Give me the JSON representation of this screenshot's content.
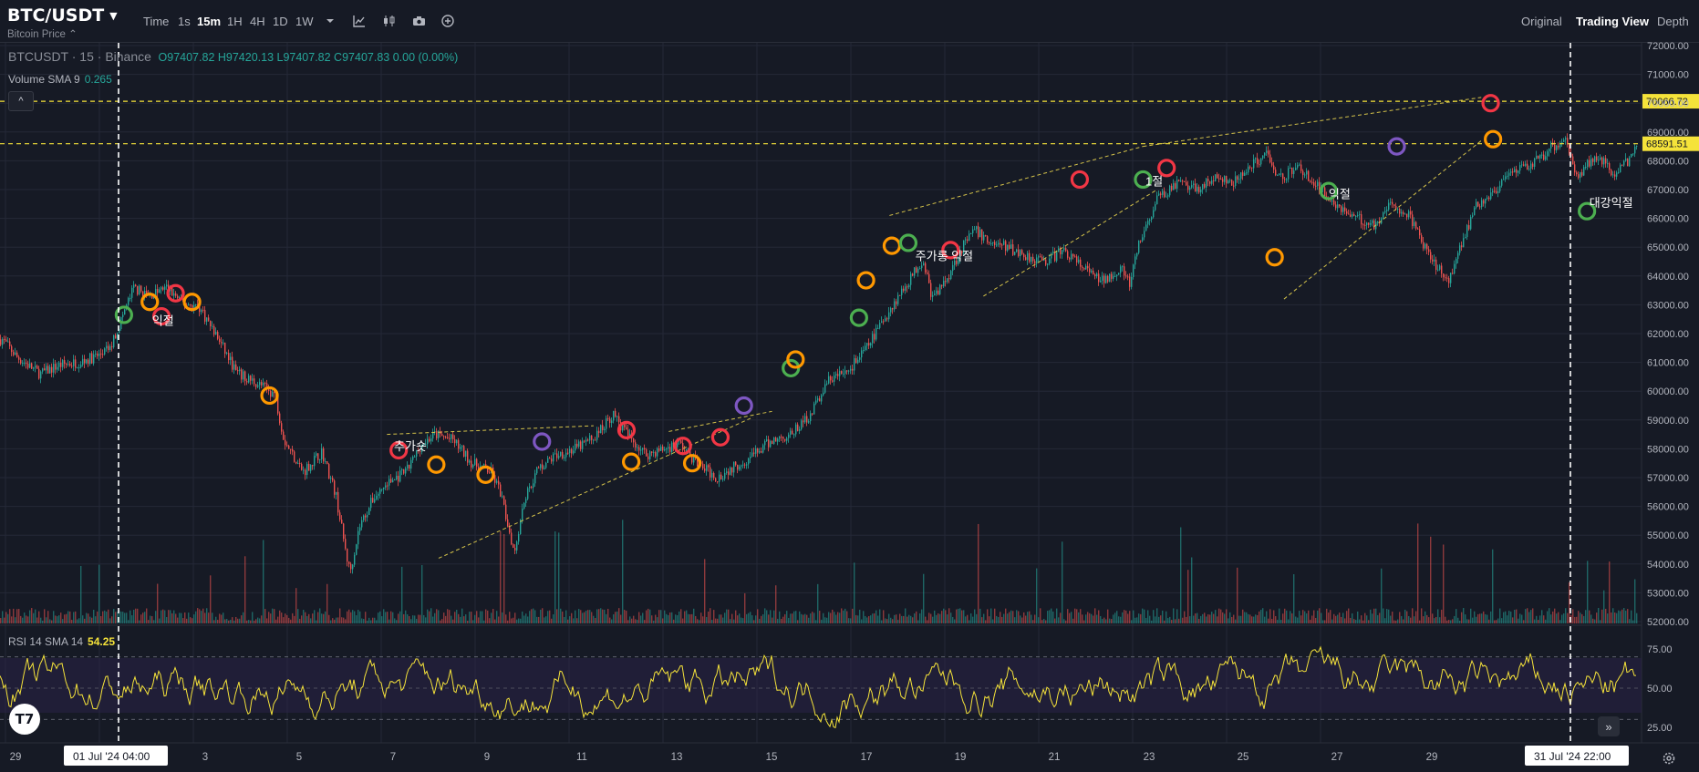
{
  "header": {
    "symbol": "BTC/USDT",
    "subtitle": "Bitcoin Price ⌃",
    "timeframes": [
      {
        "label": "Time",
        "active": false
      },
      {
        "label": "1s",
        "active": false
      },
      {
        "label": "15m",
        "active": true
      },
      {
        "label": "1H",
        "active": false
      },
      {
        "label": "4H",
        "active": false
      },
      {
        "label": "1D",
        "active": false
      },
      {
        "label": "1W",
        "active": false
      }
    ],
    "tools": [
      "chevron-down-icon",
      "indicators-icon",
      "chart-type-icon",
      "camera-icon",
      "add-icon"
    ],
    "view_tabs": [
      {
        "label": "Original",
        "active": false
      },
      {
        "label": "Trading View",
        "active": true
      },
      {
        "label": "Depth",
        "active": false
      }
    ]
  },
  "legend": {
    "symbol_line": "BTCUSDT · 15 · Binance",
    "ohlc": "O97407.82  H97420.13  L97407.82  C97407.83  0.00 (0.00%)",
    "volume_label": "Volume SMA 9",
    "volume_value": "0.265",
    "collapse_glyph": "^",
    "rsi_label": "RSI 14 SMA 14",
    "rsi_value": "54.25"
  },
  "colors": {
    "bg": "#161a25",
    "up": "#26a69a",
    "down": "#ef5350",
    "hline": "#f5e33a",
    "rsi": "#f5e33a",
    "marker_green": "#4caf50",
    "marker_orange": "#ff9800",
    "marker_red": "#f23645",
    "marker_purple": "#7e57c2"
  },
  "chart_data": {
    "type": "candlestick",
    "symbol": "BTCUSDT",
    "interval": "15",
    "ylim": [
      52000,
      72000
    ],
    "y_ticks": [
      "72000.00",
      "71000.00",
      "70000.00",
      "69000.00",
      "68000.00",
      "67000.00",
      "66000.00",
      "65000.00",
      "64000.00",
      "63000.00",
      "62000.00",
      "61000.00",
      "60000.00",
      "59000.00",
      "58000.00",
      "57000.00",
      "56000.00",
      "55000.00",
      "54000.00",
      "53000.00",
      "52000.00"
    ],
    "x_ticks": [
      "29",
      "3",
      "5",
      "7",
      "9",
      "11",
      "13",
      "15",
      "17",
      "19",
      "21",
      "23",
      "25",
      "27",
      "29"
    ],
    "cursor_dates": [
      "01 Jul '24  04:00",
      "31 Jul '24  22:00"
    ],
    "price_lines": [
      {
        "value": 70066.72,
        "label": "70066.72"
      },
      {
        "value": 68591.51,
        "label": "68591.51"
      }
    ],
    "price_path": [
      [
        0,
        61800
      ],
      [
        0.3,
        61200
      ],
      [
        0.8,
        60600
      ],
      [
        1.2,
        60900
      ],
      [
        1.6,
        61000
      ],
      [
        2,
        61200
      ],
      [
        2.3,
        61500
      ],
      [
        2.6,
        62800
      ],
      [
        2.8,
        63600
      ],
      [
        3.1,
        63300
      ],
      [
        3.5,
        63600
      ],
      [
        3.8,
        63100
      ],
      [
        4.2,
        62900
      ],
      [
        4.6,
        61800
      ],
      [
        5.0,
        60600
      ],
      [
        5.4,
        60300
      ],
      [
        5.8,
        59900
      ],
      [
        6.0,
        58300
      ],
      [
        6.4,
        57200
      ],
      [
        6.8,
        57900
      ],
      [
        7.1,
        56400
      ],
      [
        7.3,
        54500
      ],
      [
        7.4,
        53700
      ],
      [
        7.6,
        55300
      ],
      [
        7.9,
        56300
      ],
      [
        8.2,
        56800
      ],
      [
        8.6,
        57200
      ],
      [
        8.9,
        58100
      ],
      [
        9.2,
        58500
      ],
      [
        9.6,
        58300
      ],
      [
        10.0,
        57500
      ],
      [
        10.4,
        57200
      ],
      [
        10.6,
        56500
      ],
      [
        10.9,
        54400
      ],
      [
        11.1,
        56200
      ],
      [
        11.4,
        57300
      ],
      [
        11.8,
        57800
      ],
      [
        12.2,
        58000
      ],
      [
        12.6,
        58400
      ],
      [
        13.0,
        59200
      ],
      [
        13.3,
        58500
      ],
      [
        13.7,
        57800
      ],
      [
        14.1,
        58000
      ],
      [
        14.4,
        58200
      ],
      [
        14.8,
        57500
      ],
      [
        15.2,
        57000
      ],
      [
        15.6,
        57400
      ],
      [
        16.0,
        57800
      ],
      [
        16.4,
        58300
      ],
      [
        16.8,
        58500
      ],
      [
        17.2,
        59200
      ],
      [
        17.6,
        60400
      ],
      [
        18.0,
        60700
      ],
      [
        18.4,
        61500
      ],
      [
        18.8,
        62600
      ],
      [
        19.2,
        63600
      ],
      [
        19.6,
        64600
      ],
      [
        19.8,
        63200
      ],
      [
        20.1,
        63900
      ],
      [
        20.4,
        64900
      ],
      [
        20.7,
        65600
      ],
      [
        21.0,
        65200
      ],
      [
        21.4,
        65000
      ],
      [
        21.8,
        64700
      ],
      [
        22.2,
        64500
      ],
      [
        22.6,
        64900
      ],
      [
        23.0,
        64300
      ],
      [
        23.4,
        63800
      ],
      [
        23.8,
        64300
      ],
      [
        24.0,
        63700
      ],
      [
        24.2,
        65100
      ],
      [
        24.6,
        66700
      ],
      [
        25.0,
        67200
      ],
      [
        25.4,
        67000
      ],
      [
        25.8,
        67400
      ],
      [
        26.2,
        67200
      ],
      [
        26.6,
        67800
      ],
      [
        26.9,
        68300
      ],
      [
        27.2,
        67400
      ],
      [
        27.6,
        67800
      ],
      [
        28.0,
        67100
      ],
      [
        28.4,
        66500
      ],
      [
        28.8,
        66000
      ],
      [
        29.2,
        65800
      ],
      [
        29.6,
        66500
      ],
      [
        30.0,
        66000
      ],
      [
        30.2,
        65200
      ],
      [
        30.5,
        64400
      ],
      [
        30.8,
        63900
      ],
      [
        31.0,
        64900
      ],
      [
        31.4,
        66500
      ],
      [
        31.8,
        67000
      ],
      [
        32.2,
        67600
      ],
      [
        32.6,
        67900
      ],
      [
        33.0,
        68500
      ],
      [
        33.3,
        68800
      ],
      [
        33.5,
        67400
      ],
      [
        33.9,
        68200
      ],
      [
        34.3,
        67600
      ],
      [
        34.7,
        68100
      ],
      [
        35.0,
        69400
      ],
      [
        35.3,
        70000
      ],
      [
        35.5,
        68800
      ],
      [
        35.9,
        66500
      ],
      [
        36.2,
        66800
      ],
      [
        36.6,
        66400
      ],
      [
        37.0,
        66100
      ],
      [
        37.4,
        66300
      ],
      [
        37.8,
        66000
      ],
      [
        38.2,
        65600
      ],
      [
        38.6,
        64100
      ],
      [
        38.9,
        63500
      ],
      [
        39.1,
        64300
      ],
      [
        39.3,
        62600
      ],
      [
        39.5,
        63300
      ],
      [
        39.8,
        65200
      ]
    ],
    "markers": [
      {
        "date": 2.6,
        "price": 62650,
        "color": "green"
      },
      {
        "date": 3.15,
        "price": 63100,
        "color": "orange"
      },
      {
        "date": 3.4,
        "price": 62600,
        "color": "red"
      },
      {
        "date": 3.7,
        "price": 63400,
        "color": "red"
      },
      {
        "date": 4.05,
        "price": 63100,
        "color": "orange"
      },
      {
        "date": 5.7,
        "price": 59850,
        "color": "orange"
      },
      {
        "date": 8.45,
        "price": 57950,
        "color": "red"
      },
      {
        "date": 9.25,
        "price": 57450,
        "color": "orange"
      },
      {
        "date": 10.3,
        "price": 57100,
        "color": "orange"
      },
      {
        "date": 11.5,
        "price": 58250,
        "color": "purple"
      },
      {
        "date": 13.3,
        "price": 58650,
        "color": "red"
      },
      {
        "date": 13.4,
        "price": 57550,
        "color": "orange"
      },
      {
        "date": 14.5,
        "price": 58100,
        "color": "red"
      },
      {
        "date": 14.7,
        "price": 57500,
        "color": "orange"
      },
      {
        "date": 15.3,
        "price": 58400,
        "color": "red"
      },
      {
        "date": 15.8,
        "price": 59500,
        "color": "purple"
      },
      {
        "date": 16.8,
        "price": 60800,
        "color": "green"
      },
      {
        "date": 16.9,
        "price": 61100,
        "color": "orange"
      },
      {
        "date": 18.25,
        "price": 62550,
        "color": "green"
      },
      {
        "date": 18.4,
        "price": 63850,
        "color": "orange"
      },
      {
        "date": 18.95,
        "price": 65050,
        "color": "orange"
      },
      {
        "date": 19.3,
        "price": 65150,
        "color": "green"
      },
      {
        "date": 20.2,
        "price": 64900,
        "color": "red"
      },
      {
        "date": 22.95,
        "price": 67350,
        "color": "red"
      },
      {
        "date": 24.3,
        "price": 67350,
        "color": "green"
      },
      {
        "date": 24.8,
        "price": 67750,
        "color": "red"
      },
      {
        "date": 27.1,
        "price": 64650,
        "color": "orange"
      },
      {
        "date": 28.25,
        "price": 66950,
        "color": "green"
      },
      {
        "date": 29.7,
        "price": 68500,
        "color": "purple"
      },
      {
        "date": 31.7,
        "price": 70000,
        "color": "red"
      },
      {
        "date": 31.75,
        "price": 68750,
        "color": "orange"
      },
      {
        "date": 33.75,
        "price": 66250,
        "color": "green"
      }
    ],
    "annotations": [
      {
        "text": "익절",
        "date": 3.2,
        "price": 62300
      },
      {
        "text": "추가숏",
        "date": 8.35,
        "price": 57950
      },
      {
        "text": "주가롱 익절",
        "date": 19.45,
        "price": 64550
      },
      {
        "text": "1절",
        "date": 24.35,
        "price": 67150
      },
      {
        "text": "익절",
        "date": 28.25,
        "price": 66700
      },
      {
        "text": "대강익절",
        "date": 33.8,
        "price": 66400
      }
    ],
    "trendlines": [
      {
        "from": [
          8.2,
          58500
        ],
        "to": [
          12.6,
          58800
        ]
      },
      {
        "from": [
          9.3,
          54200
        ],
        "to": [
          16.0,
          59100
        ]
      },
      {
        "from": [
          14.2,
          58600
        ],
        "to": [
          16.4,
          59300
        ]
      },
      {
        "from": [
          18.9,
          66100
        ],
        "to": [
          24.3,
          68500
        ]
      },
      {
        "from": [
          20.9,
          63300
        ],
        "to": [
          24.6,
          67000
        ]
      },
      {
        "from": [
          24.3,
          68500
        ],
        "to": [
          31.5,
          70200
        ]
      },
      {
        "from": [
          27.3,
          63200
        ],
        "to": [
          31.5,
          68700
        ]
      }
    ],
    "rsi": {
      "levels": [
        70,
        50,
        30
      ],
      "ylim": [
        15,
        85
      ],
      "ticks": [
        "75.00",
        "50.00",
        "25.00"
      ],
      "last": 54.25
    }
  }
}
